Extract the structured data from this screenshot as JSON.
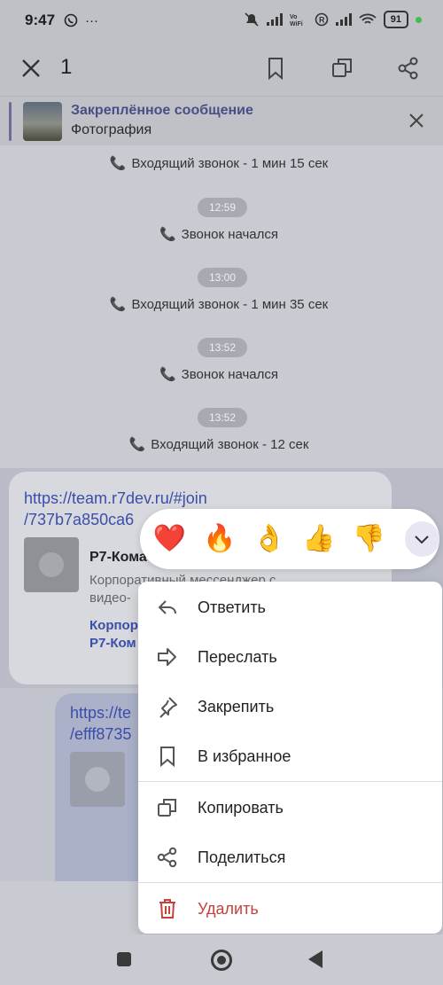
{
  "status_bar": {
    "time": "9:47",
    "battery": "91"
  },
  "app_bar": {
    "selected_count": "1"
  },
  "pinned": {
    "title": "Закреплённое сообщение",
    "subtitle": "Фотография"
  },
  "feed": {
    "events": [
      {
        "time": "",
        "text": "Входящий звонок - 1 мин 15 сек"
      },
      {
        "time": "12:59",
        "text": "Звонок начался"
      },
      {
        "time": "13:00",
        "text": "Входящий звонок - 1 мин 35 сек"
      },
      {
        "time": "13:52",
        "text": "Звонок начался"
      },
      {
        "time": "13:52",
        "text": "Входящий звонок - 12 сек"
      }
    ],
    "message1": {
      "link_line1": "https://team.r7dev.ru/#join",
      "link_line2": "/737b7a850ca6",
      "preview_title": "Р7-Кома",
      "preview_desc_line1": "Корпоративный мессенджер с",
      "preview_desc_line2": "видео-",
      "preview_link_line1": "Корпор",
      "preview_link_line2": "Р7-Ком"
    },
    "message2": {
      "link_line1": "https://te",
      "link_line2": "/efff8735"
    }
  },
  "reactions": [
    "❤️",
    "🔥",
    "👌",
    "👍",
    "👎"
  ],
  "menu": {
    "items": [
      {
        "label": "Ответить",
        "icon": "reply-icon"
      },
      {
        "label": "Переслать",
        "icon": "forward-icon"
      },
      {
        "label": "Закрепить",
        "icon": "pin-icon"
      },
      {
        "label": "В избранное",
        "icon": "bookmark-icon"
      },
      {
        "label": "Копировать",
        "icon": "copy-icon"
      },
      {
        "label": "Поделиться",
        "icon": "share-icon"
      },
      {
        "label": "Удалить",
        "icon": "trash-icon"
      }
    ],
    "danger_color": "#c5413c"
  }
}
